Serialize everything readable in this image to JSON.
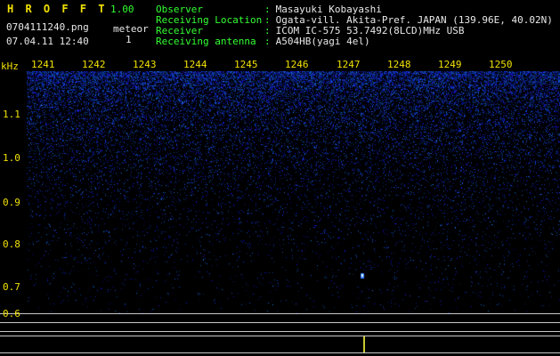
{
  "app": {
    "title_letters": "H R O F F T",
    "version": "1.00",
    "filename": "0704111240.png",
    "mode_label": "meteor",
    "meteor_count": "1",
    "datetime": "07.04.11 12:40"
  },
  "info": {
    "separator": ":",
    "rows": [
      {
        "label": "Observer",
        "value": "Masayuki Kobayashi"
      },
      {
        "label": "Receiving Location",
        "value": "Ogata-vill. Akita-Pref. JAPAN (139.96E, 40.02N)"
      },
      {
        "label": "Receiver",
        "value": "ICOM IC-575 53.7492(8LCD)MHz USB"
      },
      {
        "label": "Receiving antenna",
        "value": "A504HB(yagi 4el)"
      }
    ]
  },
  "chart_data": {
    "type": "heatmap",
    "title": "HROFFT 10-minute radio meteor spectrogram",
    "ylabel": "kHz",
    "x_tick_labels": [
      "1241",
      "1242",
      "1243",
      "1244",
      "1245",
      "1246",
      "1247",
      "1248",
      "1249",
      "1250"
    ],
    "y_tick_labels": [
      "1.1",
      "1.0",
      "0.9",
      "0.8",
      "0.7",
      "0.6"
    ],
    "y_range_khz": [
      0.6,
      1.15
    ],
    "grid": "off",
    "background": "blue noise speckle, dense at high frequencies fading to black toward low frequencies",
    "events": [
      {
        "type": "meteor-echo",
        "minute": "1247",
        "freq_khz": 0.73
      }
    ],
    "meteor_count": 1
  },
  "colors": {
    "background": "#000000",
    "title_yellow": "#f0e000",
    "label_green": "#33ff33",
    "text_white": "#e8e8e8",
    "axis_yellow": "#f0e000",
    "noise_blue": "#2233cc",
    "echo_cyan": "#d8ffff",
    "grid_gray": "#c8c8c8",
    "tick_yellow_green": "#c8c832"
  }
}
